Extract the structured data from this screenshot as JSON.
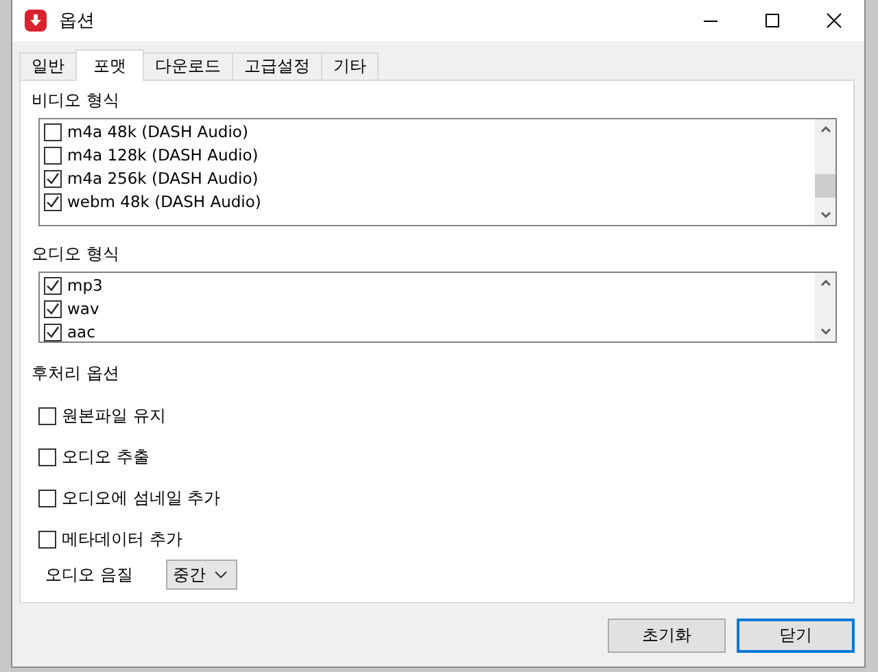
{
  "window": {
    "title": "옵션"
  },
  "tabs": [
    {
      "label": "일반",
      "selected": false
    },
    {
      "label": "포맷",
      "selected": true
    },
    {
      "label": "다운로드",
      "selected": false
    },
    {
      "label": "고급설정",
      "selected": false
    },
    {
      "label": "기타",
      "selected": false
    }
  ],
  "video_formats": {
    "label": "비디오 형식",
    "items": [
      {
        "label": "m4a 48k (DASH Audio)",
        "checked": false
      },
      {
        "label": "m4a 128k (DASH Audio)",
        "checked": false
      },
      {
        "label": "m4a 256k (DASH Audio)",
        "checked": true
      },
      {
        "label": "webm 48k (DASH Audio)",
        "checked": true
      }
    ]
  },
  "audio_formats": {
    "label": "오디오 형식",
    "items": [
      {
        "label": "mp3",
        "checked": true
      },
      {
        "label": "wav",
        "checked": true
      },
      {
        "label": "aac",
        "checked": true
      }
    ]
  },
  "post_processing": {
    "label": "후처리 옵션",
    "options": [
      {
        "label": "원본파일 유지",
        "checked": false
      },
      {
        "label": "오디오 추출",
        "checked": false
      },
      {
        "label": "오디오에 섬네일 추가",
        "checked": false
      },
      {
        "label": "메타데이터 추가",
        "checked": false
      }
    ]
  },
  "audio_quality": {
    "label": "오디오 음질",
    "value": "중간"
  },
  "buttons": [
    {
      "label": "초기화",
      "default": false
    },
    {
      "label": "닫기",
      "default": true
    }
  ]
}
